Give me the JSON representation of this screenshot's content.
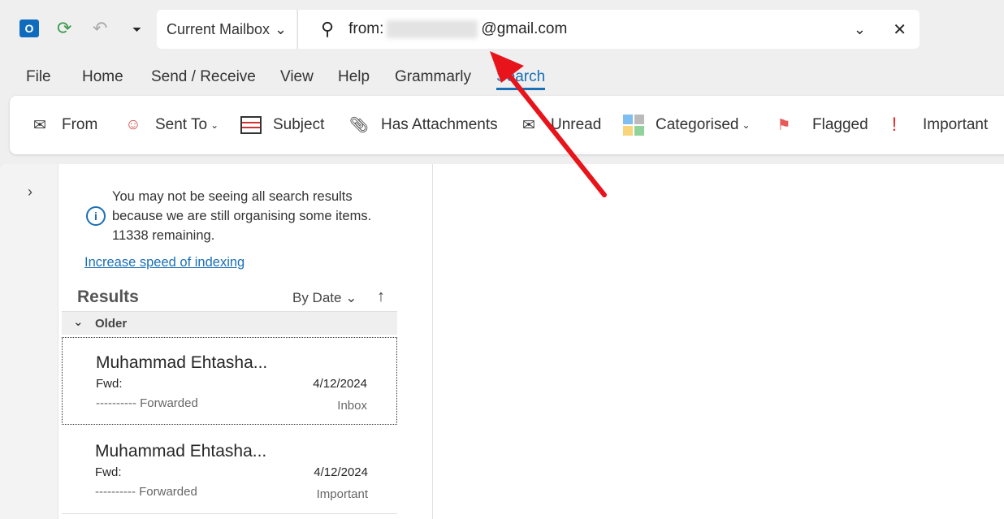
{
  "quick_access": {
    "app_icon": "outlook-icon",
    "sync_icon": "sync-icon",
    "undo_icon": "undo-icon",
    "customize_icon": "customize-toolbar-icon"
  },
  "search": {
    "scope": "Current Mailbox",
    "query_prefix": "from:",
    "query_suffix": "@gmail.com"
  },
  "tabs": [
    "File",
    "Home",
    "Send / Receive",
    "View",
    "Help",
    "Grammarly",
    "Search"
  ],
  "active_tab": "Search",
  "ribbon": [
    {
      "label": "From",
      "icon": "envelope-person-icon"
    },
    {
      "label": "Sent To",
      "icon": "person-icon"
    },
    {
      "label": "Subject",
      "icon": "subject-icon"
    },
    {
      "label": "Has Attachments",
      "icon": "paperclip-icon"
    },
    {
      "label": "Unread",
      "icon": "open-envelope-icon"
    },
    {
      "label": "Categorised",
      "icon": "categories-icon"
    },
    {
      "label": "Flagged",
      "icon": "flag-icon"
    },
    {
      "label": "Important",
      "icon": "exclamation-icon"
    }
  ],
  "notice": {
    "text": "You may not be seeing all search results because we are still organising some items. 11338 remaining.",
    "link": "Increase speed of indexing"
  },
  "results": {
    "title": "Results",
    "sort": "By Date",
    "group": "Older",
    "messages": [
      {
        "sender": "Muhammad Ehtasha...",
        "subject": "Fwd:",
        "date": "4/12/2024",
        "preview": "---------- Forwarded",
        "folder": "Inbox"
      },
      {
        "sender": "Muhammad Ehtasha...",
        "subject": "Fwd:",
        "date": "4/12/2024",
        "preview": "---------- Forwarded",
        "folder": "Important"
      }
    ]
  },
  "colors": {
    "accent": "#1a6fb5",
    "arrow": "#e8141b"
  }
}
